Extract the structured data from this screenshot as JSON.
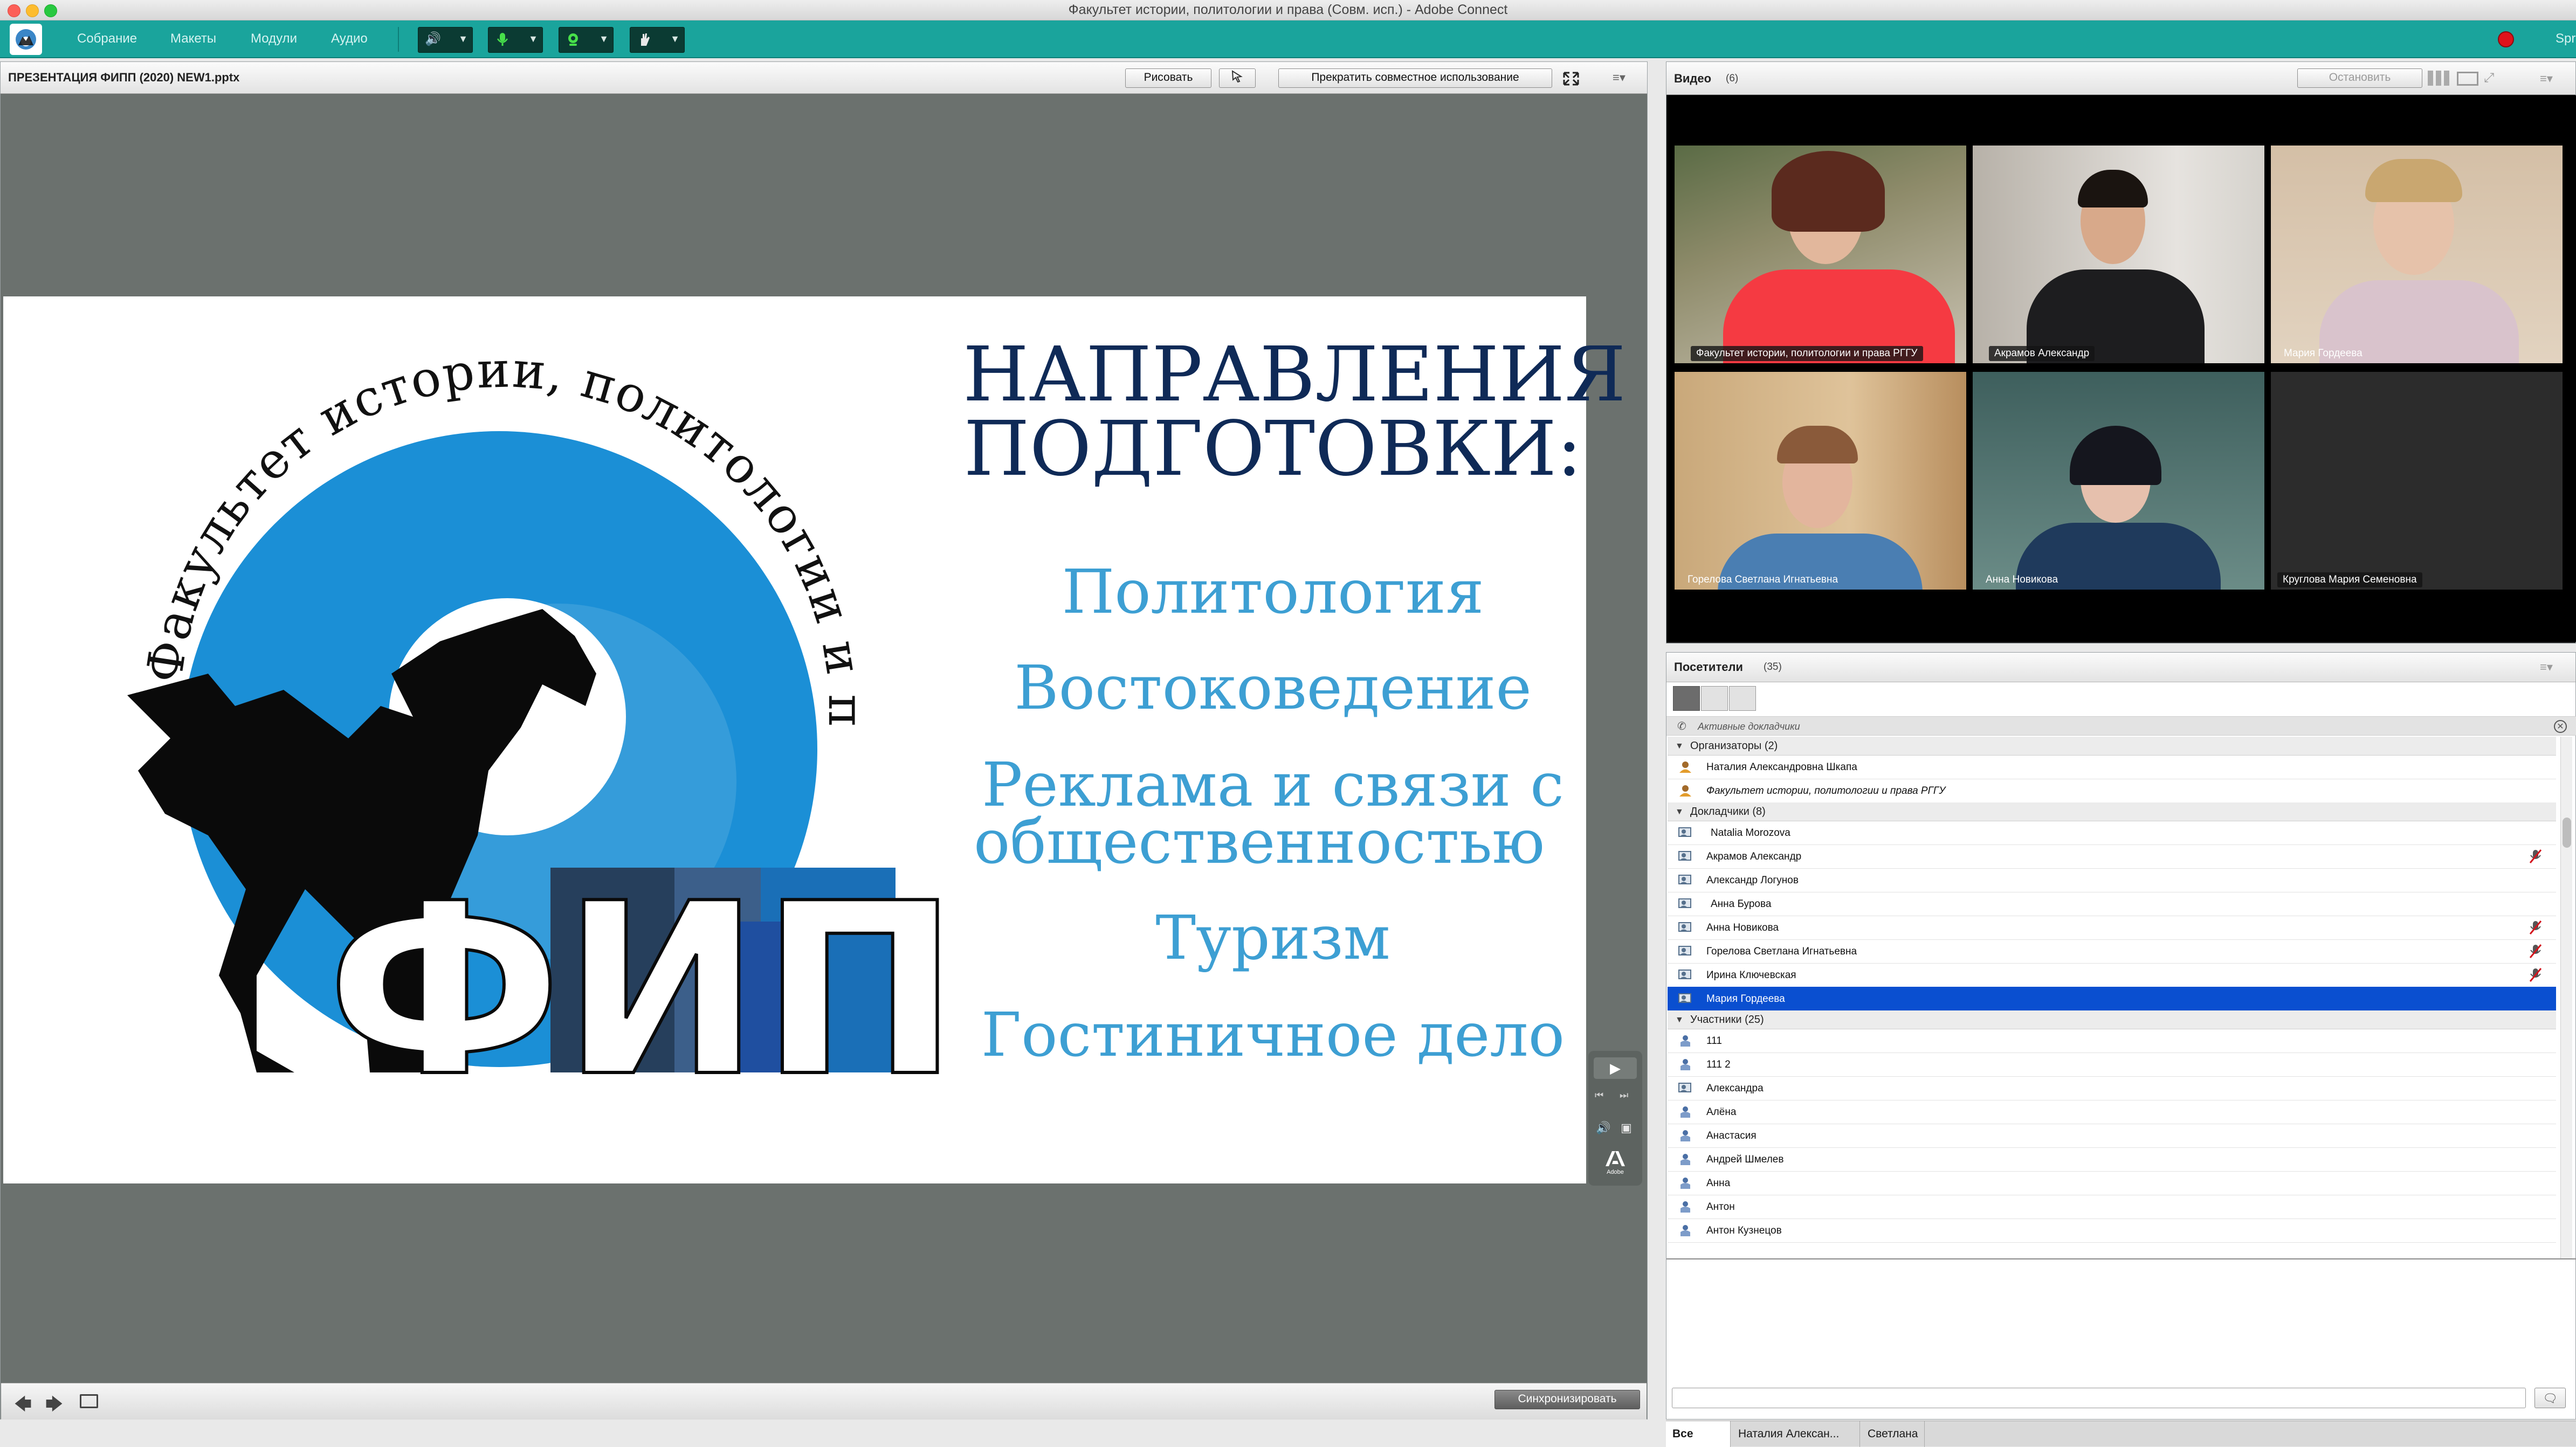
{
  "window": {
    "title": "Факультет истории, политологии и права (Совм. исп.) - Adobe Connect"
  },
  "menu": {
    "items": [
      "Собрание",
      "Макеты",
      "Модули",
      "Аудио"
    ]
  },
  "share": {
    "title": "ПРЕЗЕНТАЦИЯ ФИПП (2020) NEW1.pptx",
    "draw_label": "Рисовать",
    "stop_label": "Прекратить совместное использование",
    "sync_label": "Синхронизировать"
  },
  "slide": {
    "heading_line1": "НАПРАВЛЕНИЯ",
    "heading_line2": "ПОДГОТОВКИ:",
    "directions": [
      "Политология",
      "Востоковедение",
      "Реклама и связи с",
      "общественностью",
      "Туризм",
      "Гостиничное дело"
    ],
    "logo_arc_text": "Факультет истории, политологии и права РГГУ",
    "logo_letters": "ФИПП",
    "player_brand": "Adobe"
  },
  "video": {
    "title": "Видео",
    "count": "(6)",
    "stop_label": "Остановить",
    "tiles": [
      {
        "name": "Факультет истории, политологии и права РГГУ"
      },
      {
        "name": "Акрамов Александр"
      },
      {
        "name": "Мария Гордеева"
      },
      {
        "name": "Горелова Светлана Игнатьевна"
      },
      {
        "name": "Анна Новикова"
      },
      {
        "name": "Круглова Мария Семеновна"
      }
    ]
  },
  "attendees": {
    "title": "Посетители",
    "count": "(35)",
    "active_speakers": "Активные докладчики",
    "hosts_header": "Организаторы (2)",
    "hosts": [
      "Наталия Александровна Шкапа",
      "Факультет истории, политологии и права РГГУ"
    ],
    "presenters_header": "Докладчики (8)",
    "presenters": [
      "Natalia Morozova",
      "Акрамов Александр",
      "Александр Логунов",
      "Анна Бурова",
      "Анна Новикова",
      "Горелова Светлана Игнатьевна",
      "Ирина Ключевская",
      "Мария Гордеева"
    ],
    "participants_header": "Участники (25)",
    "participants": [
      "111",
      "111 2",
      "Александра",
      "Алёна",
      "Анастасия",
      "Андрей Шмелев",
      "Анна",
      "Антон",
      "Антон Кузнецов"
    ]
  },
  "chat": {
    "tabs": [
      "Все",
      "Наталия Алексан...",
      "Светлана"
    ]
  },
  "colors": {
    "accent": "#1aa49c",
    "selection": "#0a4fd0",
    "slide_text": "#3d9fd3",
    "slide_heading": "#0f2a57"
  }
}
